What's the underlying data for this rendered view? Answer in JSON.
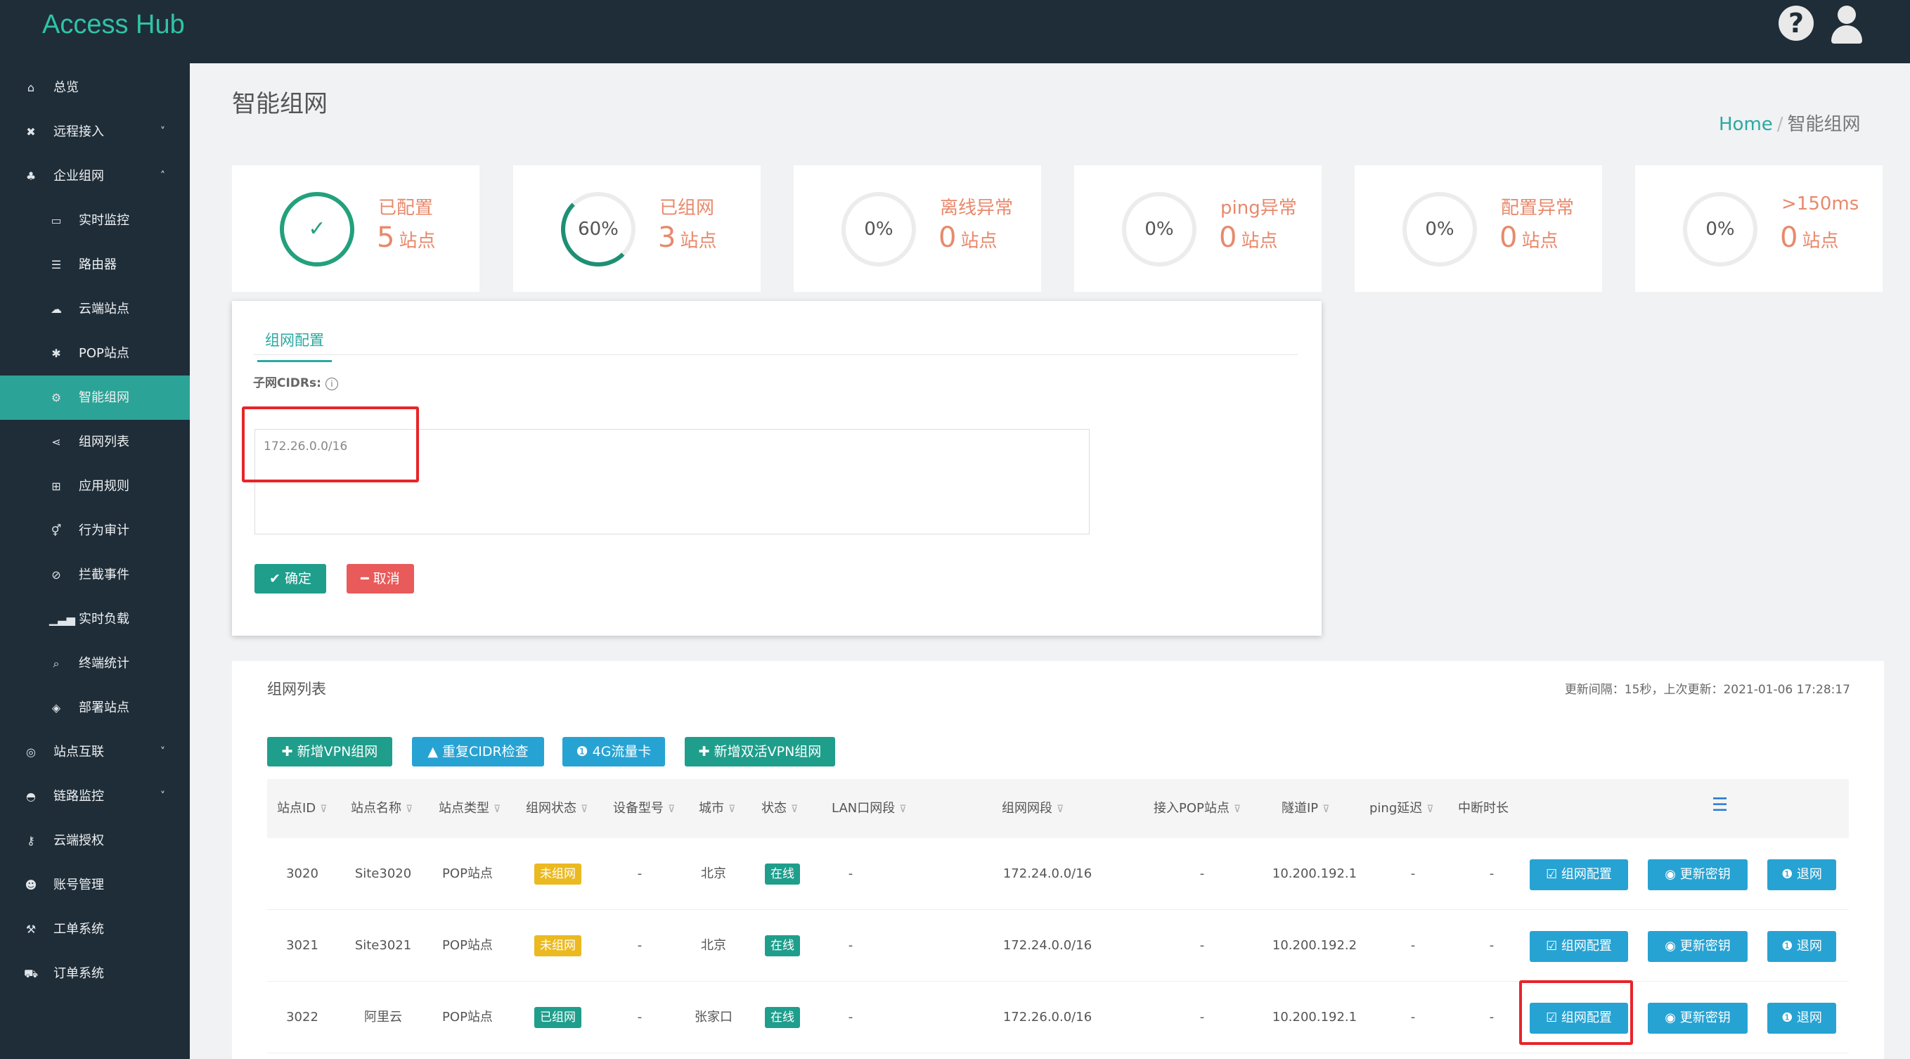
{
  "app": {
    "title": "Access Hub"
  },
  "header": {
    "help_icon": "question-circle-icon",
    "user_icon": "user-icon"
  },
  "sidebar": {
    "items": [
      {
        "label": "总览",
        "icon": "home-icon"
      },
      {
        "label": "远程接入",
        "icon": "remote-icon",
        "chevron": "˅"
      },
      {
        "label": "企业组网",
        "icon": "sitemap-icon",
        "chevron": "˄"
      },
      {
        "label": "实时监控",
        "icon": "desktop-icon"
      },
      {
        "label": "路由器",
        "icon": "list-icon"
      },
      {
        "label": "云端站点",
        "icon": "cloud-icon"
      },
      {
        "label": "POP站点",
        "icon": "asterisk-icon"
      },
      {
        "label": "智能组网",
        "icon": "gear-icon",
        "active": true
      },
      {
        "label": "组网列表",
        "icon": "share-icon"
      },
      {
        "label": "应用规则",
        "icon": "rules-icon"
      },
      {
        "label": "行为审计",
        "icon": "audit-icon"
      },
      {
        "label": "拦截事件",
        "icon": "ban-icon"
      },
      {
        "label": "实时负载",
        "icon": "signal-icon"
      },
      {
        "label": "终端统计",
        "icon": "search-icon"
      },
      {
        "label": "部署站点",
        "icon": "cube-icon"
      },
      {
        "label": "站点互联",
        "icon": "globe-icon",
        "chevron": "˅"
      },
      {
        "label": "链路监控",
        "icon": "dashboard-icon",
        "chevron": "˅"
      },
      {
        "label": "云端授权",
        "icon": "key-icon"
      },
      {
        "label": "账号管理",
        "icon": "users-icon"
      },
      {
        "label": "工单系统",
        "icon": "wrench-icon"
      },
      {
        "label": "订单系统",
        "icon": "cart-icon"
      }
    ]
  },
  "page": {
    "title": "智能组网",
    "breadcrumb": {
      "home": "Home",
      "separator": "/",
      "current": "智能组网"
    }
  },
  "stats": [
    {
      "ring": "✓",
      "label": "已配置",
      "value": "5",
      "unit": "站点"
    },
    {
      "ring": "60%",
      "label": "已组网",
      "value": "3",
      "unit": "站点",
      "percent": 60
    },
    {
      "ring": "0%",
      "label": "离线异常",
      "value": "0",
      "unit": "站点"
    },
    {
      "ring": "0%",
      "label": "ping异常",
      "value": "0",
      "unit": "站点"
    },
    {
      "ring": "0%",
      "label": "配置异常",
      "value": "0",
      "unit": "站点"
    },
    {
      "ring": "0%",
      "label": ">150ms",
      "value": "0",
      "unit": "站点"
    }
  ],
  "config_form": {
    "tab": "组网配置",
    "cidr_label": "子网CIDRs:",
    "info_icon": "i",
    "cidr_value": "172.26.0.0/16",
    "confirm": "✔ 确定",
    "cancel": "━ 取消"
  },
  "list": {
    "title": "组网列表",
    "update_info": "更新间隔：15秒，上次更新：2021-01-06 17:28:17",
    "toolbar": {
      "add_vpn": "✚ 新增VPN组网",
      "recheck_cidr": "▲ 重复CIDR检查",
      "4g_card": "❶ 4G流量卡",
      "add_dual_vpn": "✚ 新增双活VPN组网"
    },
    "columns": [
      "站点ID",
      "站点名称",
      "站点类型",
      "组网状态",
      "设备型号",
      "城市",
      "状态",
      "LAN口网段",
      "组网网段",
      "接入POP站点",
      "隧道IP",
      "ping延迟",
      "中断时长"
    ],
    "filter_icon": "⊽",
    "columns_icon": "☰",
    "rows": [
      {
        "id": "3020",
        "name": "Site3020",
        "type": "POP站点",
        "net_status": "未组网",
        "model": "-",
        "city": "北京",
        "status": "在线",
        "lan": "-",
        "net": "172.24.0.0/16",
        "pop": "-",
        "tunnel_ip": "10.200.192.1",
        "ping": "-",
        "downtime": "-",
        "btn_config": "☑ 组网配置",
        "btn_key": "◉ 更新密钥",
        "btn_quit": "❶ 退网"
      },
      {
        "id": "3021",
        "name": "Site3021",
        "type": "POP站点",
        "net_status": "未组网",
        "model": "-",
        "city": "北京",
        "status": "在线",
        "lan": "-",
        "net": "172.24.0.0/16",
        "pop": "-",
        "tunnel_ip": "10.200.192.2",
        "ping": "-",
        "downtime": "-",
        "btn_config": "☑ 组网配置",
        "btn_key": "◉ 更新密钥",
        "btn_quit": "❶ 退网"
      },
      {
        "id": "3022",
        "name": "阿里云",
        "type": "POP站点",
        "net_status": "已组网",
        "model": "-",
        "city": "张家口",
        "status": "在线",
        "lan": "-",
        "net": "172.26.0.0/16",
        "pop": "-",
        "tunnel_ip": "10.200.192.1",
        "ping": "-",
        "downtime": "-",
        "btn_config": "☑ 组网配置",
        "btn_key": "◉ 更新密钥",
        "btn_quit": "❶ 退网"
      }
    ]
  },
  "colors": {
    "sidebar_bg": "#1f2d38",
    "accent": "#2ba396",
    "warning": "#e8896c",
    "danger": "#e95a5a",
    "info": "#27a3d3",
    "highlight_box": "#e8242a"
  }
}
